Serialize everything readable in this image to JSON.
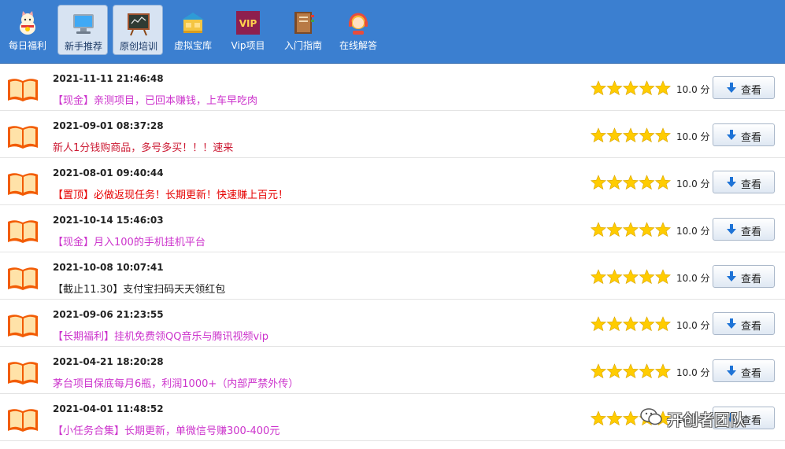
{
  "toolbar": {
    "items": [
      {
        "label": "每日福利",
        "icon": "lucky-cat-icon",
        "active": false
      },
      {
        "label": "新手推荐",
        "icon": "computer-icon",
        "active": true
      },
      {
        "label": "原创培训",
        "icon": "chalkboard-icon",
        "active": true
      },
      {
        "label": "虚拟宝库",
        "icon": "treasure-icon",
        "active": false
      },
      {
        "label": "Vip项目",
        "icon": "vip-icon",
        "active": false
      },
      {
        "label": "入门指南",
        "icon": "guide-book-icon",
        "active": false
      },
      {
        "label": "在线解答",
        "icon": "support-agent-icon",
        "active": false
      }
    ]
  },
  "items": [
    {
      "date": "2021-11-11 21:46:48",
      "title": "【现金】亲测项目，已回本赚钱，上车早吃肉",
      "color": "#cc33cc",
      "score": "10.0 分",
      "stars": 5
    },
    {
      "date": "2021-09-01 08:37:28",
      "title": "新人1分钱购商品，多号多买！！！速来",
      "color": "#cc1a33",
      "score": "10.0 分",
      "stars": 5
    },
    {
      "date": "2021-08-01 09:40:44",
      "title": "【置顶】必做返现任务！长期更新！快速赚上百元！",
      "color": "#e60000",
      "score": "10.0 分",
      "stars": 5
    },
    {
      "date": "2021-10-14 15:46:03",
      "title": "【现金】月入100的手机挂机平台",
      "color": "#cc33cc",
      "score": "10.0 分",
      "stars": 5
    },
    {
      "date": "2021-10-08 10:07:41",
      "title": "【截止11.30】支付宝扫码天天领红包",
      "color": "#222222",
      "score": "10.0 分",
      "stars": 5
    },
    {
      "date": "2021-09-06 21:23:55",
      "title": "【长期福利】挂机免费领QQ音乐与腾讯视频vip",
      "color": "#cc33cc",
      "score": "10.0 分",
      "stars": 5
    },
    {
      "date": "2021-04-21 18:20:28",
      "title": "茅台项目保底每月6瓶，利润1000+（内部严禁外传）",
      "color": "#cc33cc",
      "score": "10.0 分",
      "stars": 5
    },
    {
      "date": "2021-04-01 11:48:52",
      "title": "【小任务合集】长期更新，单微信号赚300-400元",
      "color": "#cc33cc",
      "score": "10.0 分",
      "stars": 5
    }
  ],
  "view_label": "查看",
  "watermark": {
    "text": "开创者团队"
  },
  "colors": {
    "toolbar_bg": "#3b7fd0",
    "star": "#ffcc00",
    "book": "#f25c05"
  }
}
